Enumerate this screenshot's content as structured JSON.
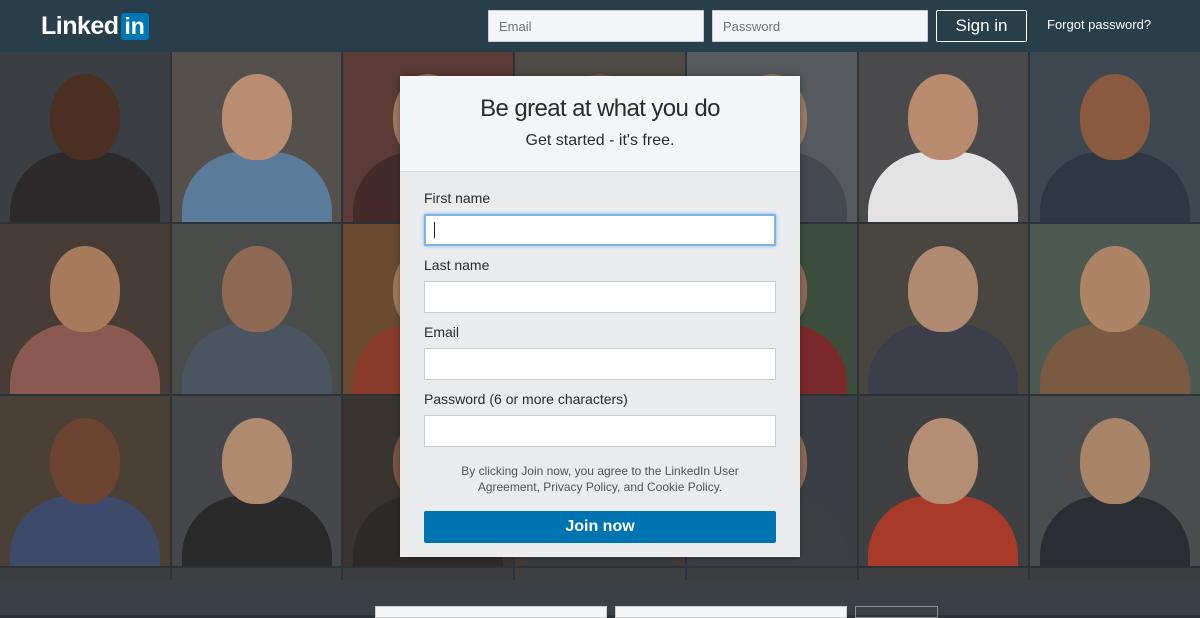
{
  "header": {
    "logo_text": "Linked",
    "logo_badge": "in",
    "email_placeholder": "Email",
    "password_placeholder": "Password",
    "signin_label": "Sign in",
    "forgot_label": "Forgot password?"
  },
  "card": {
    "title": "Be great at what you do",
    "subtitle": "Get started - it's free.",
    "fields": [
      {
        "label": "First name",
        "value": ""
      },
      {
        "label": "Last name",
        "value": ""
      },
      {
        "label": "Email",
        "value": ""
      },
      {
        "label": "Password (6 or more characters)",
        "value": ""
      }
    ],
    "agreement": "By clicking Join now, you agree to the LinkedIn User Agreement, Privacy Policy, and Cookie Policy.",
    "join_label": "Join now"
  },
  "colors": {
    "nav_bg": "#283e4a",
    "brand_blue": "#0073b1",
    "focus_ring": "#7bb5e6"
  },
  "background": {
    "tiles": [
      {
        "bg": "#3b3f44",
        "skin": "#4a2f22",
        "cloth": "#2c2a2a"
      },
      {
        "bg": "#56504c",
        "skin": "#b98d72",
        "cloth": "#5b7b9a"
      },
      {
        "bg": "#5b3b35",
        "skin": "#a07a62",
        "cloth": "#452a2a"
      },
      {
        "bg": "#4e4a46",
        "skin": "#7f5a46",
        "cloth": "#3d3d44"
      },
      {
        "bg": "#565a5e",
        "skin": "#9a7a66",
        "cloth": "#44484f"
      },
      {
        "bg": "#4a4a4c",
        "skin": "#b88a6e",
        "cloth": "#e3e3e3"
      },
      {
        "bg": "#3e4850",
        "skin": "#8a5a40",
        "cloth": "#2e3844"
      },
      {
        "bg": "#473c36",
        "skin": "#a77a5c",
        "cloth": "#8a5a52"
      },
      {
        "bg": "#4a4c4a",
        "skin": "#8e6a54",
        "cloth": "#4a5560"
      },
      {
        "bg": "#6a4a30",
        "skin": "#a0785a",
        "cloth": "#8a3a2a"
      },
      {
        "bg": "#3c3e40",
        "skin": "#7e6050",
        "cloth": "#3a3a3a"
      },
      {
        "bg": "#3e4e3e",
        "skin": "#8d6a58",
        "cloth": "#7a2a2a"
      },
      {
        "bg": "#48463f",
        "skin": "#b08a70",
        "cloth": "#3c3f4a"
      },
      {
        "bg": "#4c5a52",
        "skin": "#ae8466",
        "cloth": "#7a5a42"
      },
      {
        "bg": "#4a4036",
        "skin": "#6a4430",
        "cloth": "#3d4a6a"
      },
      {
        "bg": "#45474a",
        "skin": "#b08a6e",
        "cloth": "#2a2a2a"
      },
      {
        "bg": "#3a3430",
        "skin": "#7a5540",
        "cloth": "#2e2a28"
      },
      {
        "bg": "#433a36",
        "skin": "#7a5a4a",
        "cloth": "#3b3b3b"
      },
      {
        "bg": "#3b3f45",
        "skin": "#8a6a58",
        "cloth": "#3c4044"
      },
      {
        "bg": "#3e4042",
        "skin": "#b48e74",
        "cloth": "#a83a2a"
      },
      {
        "bg": "#4a4c4e",
        "skin": "#a88468",
        "cloth": "#2a2e34"
      },
      {
        "bg": "#3b3d3f",
        "skin": "#3b3d3f",
        "cloth": "#3b3d3f"
      },
      {
        "bg": "#3d3f41",
        "skin": "#3d3f41",
        "cloth": "#3d3f41"
      },
      {
        "bg": "#3b3d3f",
        "skin": "#3b3d3f",
        "cloth": "#3b3d3f"
      },
      {
        "bg": "#3d3f41",
        "skin": "#3d3f41",
        "cloth": "#3d3f41"
      },
      {
        "bg": "#3b3d3f",
        "skin": "#3b3d3f",
        "cloth": "#3b3d3f"
      },
      {
        "bg": "#3d3f41",
        "skin": "#3d3f41",
        "cloth": "#3d3f41"
      },
      {
        "bg": "#3b3d3f",
        "skin": "#3b3d3f",
        "cloth": "#3b3d3f"
      }
    ]
  }
}
